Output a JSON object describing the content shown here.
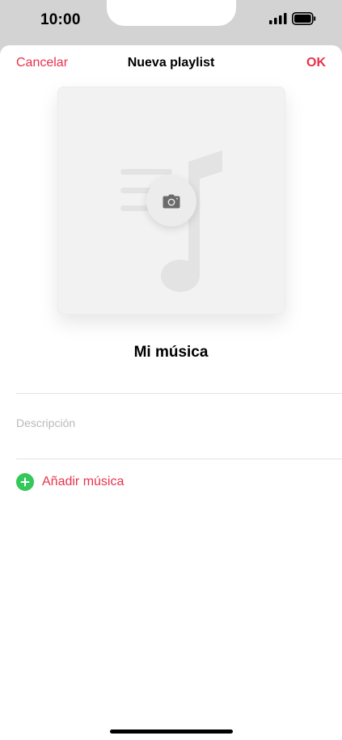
{
  "status_bar": {
    "time": "10:00"
  },
  "nav": {
    "cancel_label": "Cancelar",
    "title": "Nueva playlist",
    "ok_label": "OK"
  },
  "playlist": {
    "name": "Mi música",
    "description_placeholder": "Descripción",
    "description_value": ""
  },
  "actions": {
    "add_music_label": "Añadir música"
  },
  "icons": {
    "signal": "cellular-signal-icon",
    "battery": "battery-icon",
    "artwork": "music-note-placeholder-icon",
    "camera": "camera-icon",
    "add": "plus-circle-icon"
  },
  "colors": {
    "accent": "#e8324b",
    "add_icon": "#34c759",
    "placeholder_text": "#b9b9b9",
    "artwork_background": "#f2f2f2",
    "status_bar_background": "#d3d3d3"
  }
}
